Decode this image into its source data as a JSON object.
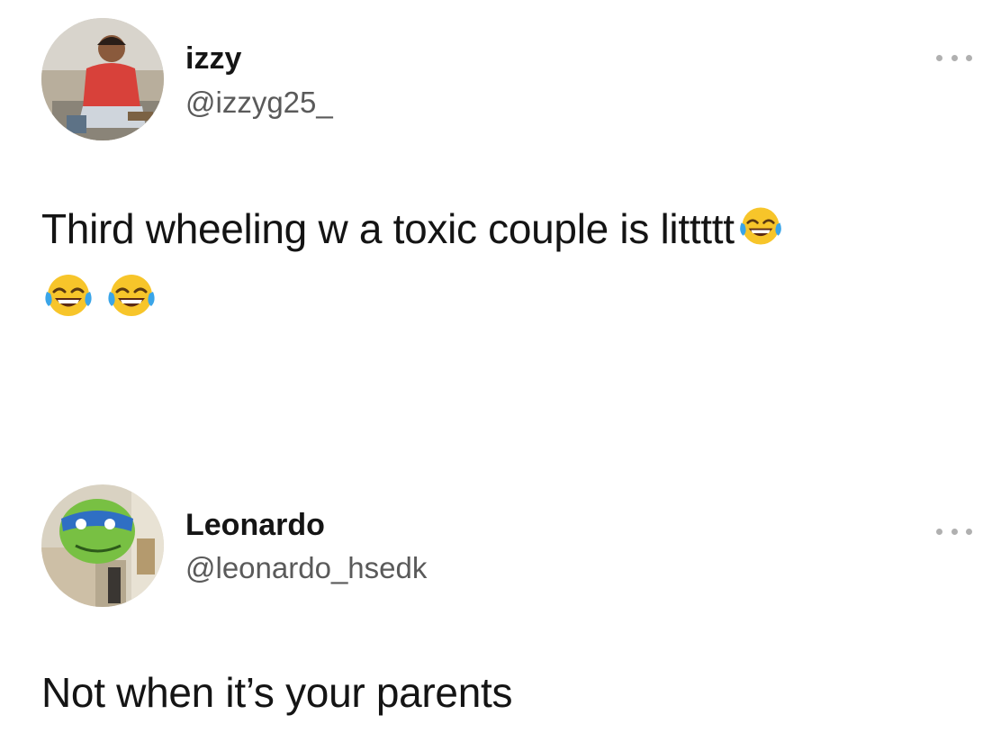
{
  "tweets": [
    {
      "display_name": "izzy",
      "handle": "@izzyg25_",
      "text": "Third wheeling w a toxic couple is littttt",
      "emojis": [
        "face-with-tears-of-joy-icon",
        "face-with-tears-of-joy-icon",
        "face-with-tears-of-joy-icon"
      ],
      "avatar": "user-photo-avatar"
    },
    {
      "display_name": "Leonardo",
      "handle": "@leonardo_hsedk",
      "text": "Not when it’s your parents",
      "avatar": "ninja-turtle-avatar"
    }
  ],
  "icons": {
    "more": "more-options-icon"
  },
  "colors": {
    "background": "#ffffff",
    "text": "#141414",
    "handle": "#5a5a5a",
    "more_dots": "#b0b0b0",
    "emoji_face": "#f7c52a"
  }
}
